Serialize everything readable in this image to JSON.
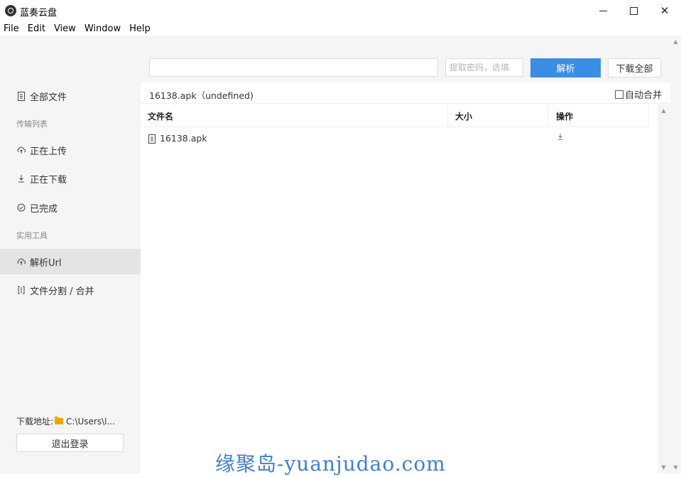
{
  "window": {
    "title": "蓝奏云盘",
    "minimize_label": "",
    "maximize_label": "",
    "close_label": "✕"
  },
  "menu": [
    "File",
    "Edit",
    "View",
    "Window",
    "Help"
  ],
  "sidebar": {
    "all_files": "全部文件",
    "transfer_section": "传输列表",
    "uploading": "正在上传",
    "downloading": "正在下载",
    "completed": "已完成",
    "tools_section": "实用工具",
    "parse_url": "解析Url",
    "split_merge": "文件分割 / 合并",
    "download_path_label": "下载地址:",
    "download_path": "C:\\Users\\l...",
    "logout": "退出登录"
  },
  "toolbar": {
    "url_value": "",
    "password_placeholder": "提取密码，选填",
    "parse_button": "解析",
    "download_all_button": "下载全部"
  },
  "info": {
    "file_info": "16138.apk（undefined)",
    "auto_merge_label": "自动合并",
    "auto_merge_checked": false
  },
  "table": {
    "columns": [
      "文件名",
      "大小",
      "操作"
    ],
    "rows": [
      {
        "name": "16138.apk",
        "size": "",
        "action_icon": "download-icon"
      }
    ]
  },
  "watermark": "缘聚岛-yuanjudao.com",
  "colors": {
    "accent": "#3a8ee6",
    "sidebar_bg": "#f5f5f5",
    "active_item_bg": "#e4e4e4",
    "folder": "#f0a500",
    "watermark": "#3f7fd0"
  }
}
